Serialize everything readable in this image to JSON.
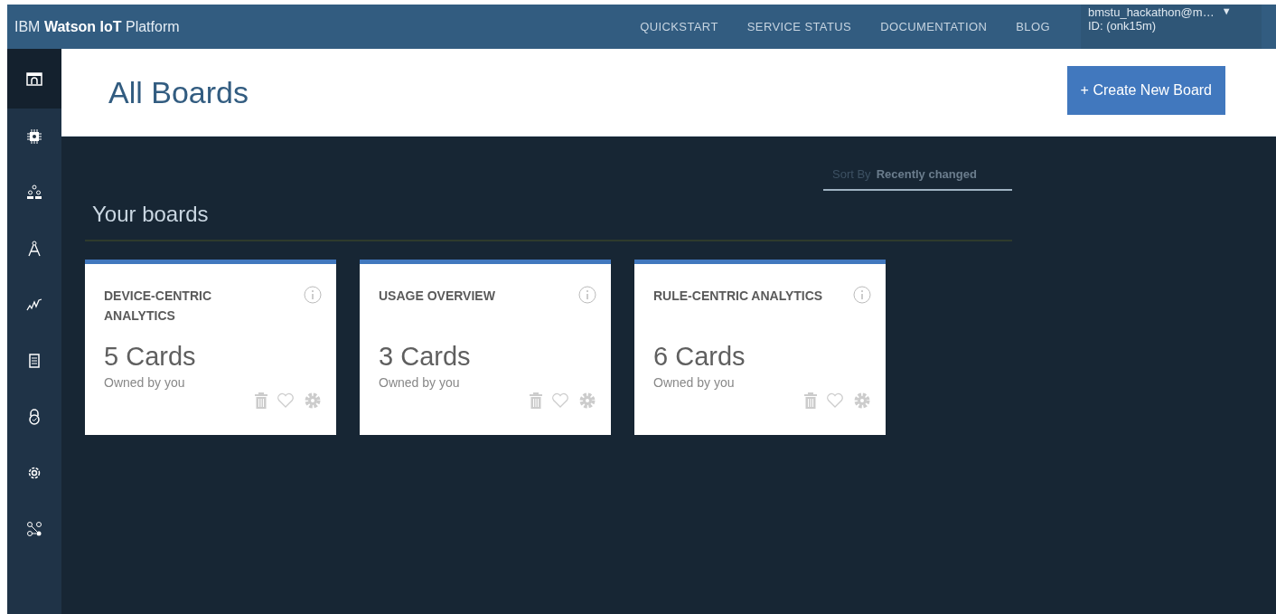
{
  "brand": {
    "prefix": "IBM",
    "name": "Watson IoT",
    "suffix": "Platform"
  },
  "nav": [
    "QUICKSTART",
    "SERVICE STATUS",
    "DOCUMENTATION",
    "BLOG"
  ],
  "account": {
    "email": "bmstu_hackathon@m…",
    "caret": "▼",
    "id": "ID: (onk15m)"
  },
  "sidebar": {
    "items": [
      {
        "kind": "dashboard",
        "selected": true
      },
      {
        "kind": "chip",
        "selected": false
      },
      {
        "kind": "members",
        "selected": false
      },
      {
        "kind": "compass",
        "selected": false
      },
      {
        "kind": "chart",
        "selected": false
      },
      {
        "kind": "document",
        "selected": false
      },
      {
        "kind": "lock",
        "selected": false
      },
      {
        "kind": "gear",
        "selected": false
      },
      {
        "kind": "network",
        "selected": false
      }
    ]
  },
  "page": {
    "title": "All Boards",
    "create_button": "+ Create New Board"
  },
  "sort": {
    "label": "Sort By",
    "value": "Recently changed"
  },
  "section_title": "Your boards",
  "boards": [
    {
      "title": "DEVICE-CENTRIC ANALYTICS",
      "count": "5 Cards",
      "owner": "Owned by you"
    },
    {
      "title": "USAGE OVERVIEW",
      "count": "3 Cards",
      "owner": "Owned by you"
    },
    {
      "title": "RULE-CENTRIC ANALYTICS",
      "count": "6 Cards",
      "owner": "Owned by you"
    }
  ]
}
